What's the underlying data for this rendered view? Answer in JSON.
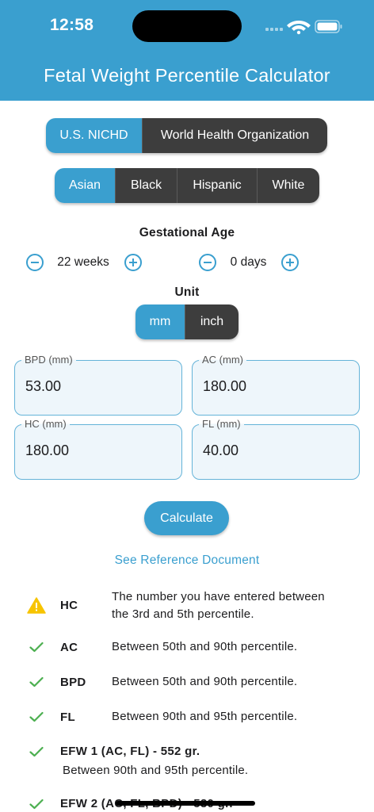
{
  "status": {
    "time": "12:58"
  },
  "header": {
    "title": "Fetal Weight Percentile Calculator"
  },
  "standard_tabs": [
    {
      "label": "U.S. NICHD",
      "active": true
    },
    {
      "label": "World Health Organization",
      "active": false
    }
  ],
  "ethnicity_tabs": [
    {
      "label": "Asian",
      "active": true
    },
    {
      "label": "Black",
      "active": false
    },
    {
      "label": "Hispanic",
      "active": false
    },
    {
      "label": "White",
      "active": false
    }
  ],
  "gestational_age": {
    "title": "Gestational Age",
    "weeks": "22 weeks",
    "days": "0 days"
  },
  "unit": {
    "title": "Unit",
    "options": [
      {
        "label": "mm",
        "active": true
      },
      {
        "label": "inch",
        "active": false
      }
    ]
  },
  "fields": {
    "bpd": {
      "label": "BPD (mm)",
      "value": "53.00"
    },
    "ac": {
      "label": "AC (mm)",
      "value": "180.00"
    },
    "hc": {
      "label": "HC (mm)",
      "value": "180.00"
    },
    "fl": {
      "label": "FL (mm)",
      "value": "40.00"
    }
  },
  "calculate_label": "Calculate",
  "reference_link": "See Reference Document",
  "results": [
    {
      "icon": "warning-icon",
      "label": "HC",
      "line1": "The number you have entered between",
      "line2": "the 3rd and 5th percentile."
    },
    {
      "icon": "check-icon",
      "label": "AC",
      "line1": "Between 50th and 90th percentile."
    },
    {
      "icon": "check-icon",
      "label": "BPD",
      "line1": "Between 50th and 90th percentile."
    },
    {
      "icon": "check-icon",
      "label": "FL",
      "line1": "Between 90th and 95th percentile."
    },
    {
      "icon": "check-icon",
      "label": "EFW 1 (AC, FL) - 552 gr.",
      "line1": "Between 90th and 95th percentile."
    },
    {
      "icon": "check-icon",
      "label": "EFW 2 (AC, FL, BPD) - 530 gr."
    }
  ],
  "colors": {
    "accent": "#3a9fcf",
    "segment_dark": "#3d3d3d",
    "success": "#4caf50",
    "warning": "#f7c400"
  }
}
